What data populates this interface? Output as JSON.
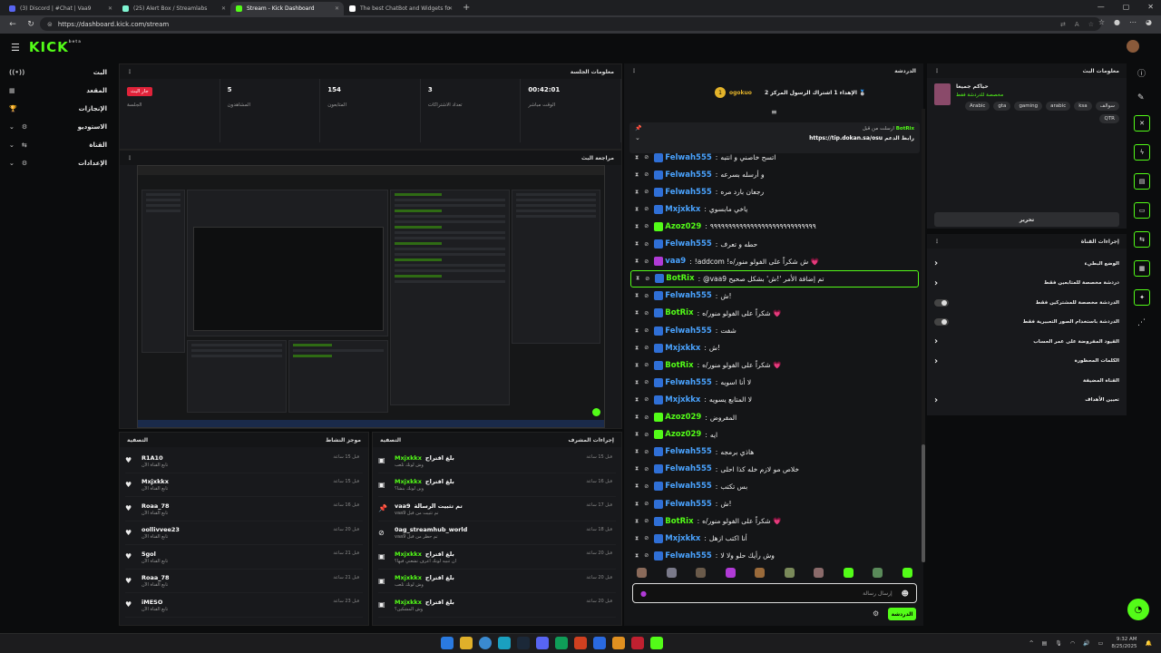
{
  "browser": {
    "tabs": [
      {
        "title": "(3) Discord | #Chat | Vaa9",
        "color": "#5865f2"
      },
      {
        "title": "(25) Alert Box / Streamlabs",
        "color": "#80f5d2"
      },
      {
        "title": "Stream - Kick Dashboard",
        "color": "#53fc18",
        "active": true
      },
      {
        "title": "The best ChatBot and Widgets fo",
        "color": "#ffffff"
      }
    ],
    "url": "https://dashboard.kick.com/stream"
  },
  "app": {
    "logo": "KICK",
    "logo_sup": "beta"
  },
  "left_nav": [
    {
      "label": "البث",
      "icon": "((•))"
    },
    {
      "label": "المقعد",
      "icon": "▦"
    },
    {
      "label": "الإنجازات",
      "icon": "🏆"
    },
    {
      "label": "الاستوديو",
      "icon": "⚙"
    },
    {
      "label": "القناة",
      "icon": "⇆"
    },
    {
      "label": "الإعدادات",
      "icon": "⚙"
    }
  ],
  "session": {
    "title": "معلومات الجلسة",
    "stats": [
      {
        "value": "جار البث",
        "label": "الجلسة",
        "badge": true
      },
      {
        "value": "5",
        "label": "المشاهدون"
      },
      {
        "value": "154",
        "label": "المتابعون"
      },
      {
        "value": "3",
        "label": "تعداد الاشتراكات"
      },
      {
        "value": "00:42:01",
        "label": "الوقت مباشر"
      }
    ]
  },
  "preview": {
    "title": "مراجعة البث"
  },
  "activity": {
    "title": "موجز النشاط",
    "filter": "التصفية",
    "items": [
      {
        "name": "R1A10",
        "sub": "تابع القناة الآن",
        "time": "قبل 15 ساعة"
      },
      {
        "name": "Mxjxkkx",
        "sub": "تابع القناة الآن",
        "time": "قبل 15 ساعة"
      },
      {
        "name": "Roaa_78",
        "sub": "تابع القناة الآن",
        "time": "قبل 16 ساعة"
      },
      {
        "name": "oollivvee23",
        "sub": "تابع القناة الآن",
        "time": "قبل 20 ساعة"
      },
      {
        "name": "5gol",
        "sub": "تابع القناة الآن",
        "time": "قبل 21 ساعة"
      },
      {
        "name": "Roaa_78",
        "sub": "تابع القناة الآن",
        "time": "قبل 21 ساعة"
      },
      {
        "name": "iMESO",
        "sub": "تابع القناة الآن",
        "time": "قبل 23 ساعة"
      }
    ]
  },
  "mod_actions": {
    "title": "إجراءات المشرف",
    "filter": "التصفية",
    "items": [
      {
        "name": "Mxjxkkx",
        "tag": "بلغ اقتراح",
        "sub": "وش لونك تلعب",
        "time": "قبل 15 ساعة",
        "green": true
      },
      {
        "name": "Mxjxkkx",
        "tag": "بلغ اقتراح",
        "sub": "وين لونك بنشا؟",
        "time": "قبل 16 ساعة",
        "green": true
      },
      {
        "name": "vaa9",
        "tag": "تم تثبيت الرسالة",
        "sub": "vaa9 تم تثبيت من قبل",
        "time": "قبل 17 ساعة",
        "green": false
      },
      {
        "name": "0ag_streamhub_world",
        "tag": "",
        "sub": "vaa9 تم حظر من قبل",
        "time": "قبل 18 ساعة",
        "green": false
      },
      {
        "name": "Mxjxkkx",
        "tag": "بلغ اقتراح",
        "sub": "ان تنبيه لونك اعرف تشعني فيها؟",
        "time": "قبل 20 ساعة",
        "green": true
      },
      {
        "name": "Mxjxkkx",
        "tag": "بلغ اقتراح",
        "sub": "وش لونك تلعب",
        "time": "قبل 20 ساعة",
        "green": true
      },
      {
        "name": "Mxjxkkx",
        "tag": "بلغ اقتراح",
        "sub": "وش المشكين؟",
        "time": "قبل 20 ساعة",
        "green": true
      }
    ]
  },
  "chat": {
    "title": "الدردشة",
    "goal_user": "ogokuo",
    "goal_count": "1",
    "goal_text": "الإهداء 1 اشتراك الرسول المركز 2 🥈",
    "pinned_by": "ارسلت من قبل",
    "pinned_user": "BotRix",
    "pinned_text": "رابط الدعم",
    "pinned_link": "https://tip.dokan.sa/osu",
    "messages": [
      {
        "user": "Felwah555",
        "text": "اتسح خاصني و انتبه",
        "color": "#4aa3ff",
        "badge": "#2f6fd6"
      },
      {
        "user": "Felwah555",
        "text": "و أرسله بسرعه",
        "color": "#4aa3ff",
        "badge": "#2f6fd6"
      },
      {
        "user": "Felwah555",
        "text": "رجعان بارد مره",
        "color": "#4aa3ff",
        "badge": "#2f6fd6"
      },
      {
        "user": "Mxjxkkx",
        "text": "ياخي مابسوي",
        "color": "#4aa3ff",
        "badge": "#2f6fd6"
      },
      {
        "user": "Azoz029",
        "text": "٩٩٩٩٩٩٩٩٩٩٩٩٩٩٩٩٩٩٩٩٩٩٩٩٩٩٩٩٩",
        "color": "#53fc18",
        "badge": "#53fc18"
      },
      {
        "user": "Felwah555",
        "text": "حطه و تعرف",
        "color": "#4aa3ff",
        "badge": "#2f6fd6"
      },
      {
        "user": "vaa9",
        "text": "!addcom !ش شكراً على الفولو منور/ه 💗",
        "color": "#4aa3ff",
        "badge": "#b03ad6"
      },
      {
        "user": "BotRix",
        "text": "@vaa9 تم إضافة الأمر '!ش' بشكل صحيح",
        "color": "#53fc18",
        "badge": "#2f6fd6",
        "highlight": true
      },
      {
        "user": "Felwah555",
        "text": "ش!",
        "color": "#4aa3ff",
        "badge": "#2f6fd6"
      },
      {
        "user": "BotRix",
        "text": "شكراً على الفولو منور/ه 💗",
        "color": "#53fc18",
        "badge": "#2f6fd6"
      },
      {
        "user": "Felwah555",
        "text": "شفت",
        "color": "#4aa3ff",
        "badge": "#2f6fd6"
      },
      {
        "user": "Mxjxkkx",
        "text": "ش!",
        "color": "#4aa3ff",
        "badge": "#2f6fd6"
      },
      {
        "user": "BotRix",
        "text": "شكراً على الفولو منور/ه 💗",
        "color": "#53fc18",
        "badge": "#2f6fd6"
      },
      {
        "user": "Felwah555",
        "text": "لا أنا اسويه",
        "color": "#4aa3ff",
        "badge": "#2f6fd6"
      },
      {
        "user": "Mxjxkkx",
        "text": "لا المتابع يسويه",
        "color": "#4aa3ff",
        "badge": "#2f6fd6"
      },
      {
        "user": "Azoz029",
        "text": "المفروض",
        "color": "#53fc18",
        "badge": "#53fc18"
      },
      {
        "user": "Azoz029",
        "text": "ايه",
        "color": "#53fc18",
        "badge": "#53fc18"
      },
      {
        "user": "Felwah555",
        "text": "هاذي برمجه",
        "color": "#4aa3ff",
        "badge": "#2f6fd6"
      },
      {
        "user": "Felwah555",
        "text": "خلاص مو لازم خله كذا احلى",
        "color": "#4aa3ff",
        "badge": "#2f6fd6"
      },
      {
        "user": "Felwah555",
        "text": "بس تكتب",
        "color": "#4aa3ff",
        "badge": "#2f6fd6"
      },
      {
        "user": "Felwah555",
        "text": "ش!",
        "color": "#4aa3ff",
        "badge": "#2f6fd6"
      },
      {
        "user": "BotRix",
        "text": "شكراً على الفولو منور/ه 💗",
        "color": "#53fc18",
        "badge": "#2f6fd6"
      },
      {
        "user": "Mxjxkkx",
        "text": "أنا اكتب ازهل",
        "color": "#4aa3ff",
        "badge": "#2f6fd6"
      },
      {
        "user": "Felwah555",
        "text": "وش رأيك حلو ولا لا",
        "color": "#4aa3ff",
        "badge": "#2f6fd6"
      }
    ],
    "input_placeholder": "إرسال رسالة",
    "send_label": "الدردشة"
  },
  "stream_info": {
    "title": "معلومات البث",
    "stream_title": "حياكم جميعا",
    "category": "مخصصة للدردشة فقط",
    "tags": [
      "Arabic",
      "gta",
      "gaming",
      "arabic",
      "ksa",
      "سوالف",
      "QTR"
    ],
    "edit_label": "تحرير"
  },
  "channel_actions": {
    "title": "إجراءات القناة",
    "rows": [
      {
        "label": "الوضع البطيء",
        "control": "chevron"
      },
      {
        "label": "دردشة مخصصة للمتابعين فقط",
        "control": "chevron"
      },
      {
        "label": "الدردشة مخصصة للمشتركين فقط",
        "control": "toggle"
      },
      {
        "label": "الدردشة باستخدام الصور التعبيرية فقط",
        "control": "toggle"
      },
      {
        "label": "القيود المفروضة على عمر الحساب",
        "control": "chevron"
      },
      {
        "label": "الكلمات المحظورة",
        "control": "chevron"
      },
      {
        "label": "القناة المضيفة",
        "control": "none"
      },
      {
        "label": "تعيين الأهداف",
        "control": "chevron"
      }
    ]
  },
  "taskbar": {
    "time": "9:32 AM",
    "date": "8/25/2025"
  }
}
